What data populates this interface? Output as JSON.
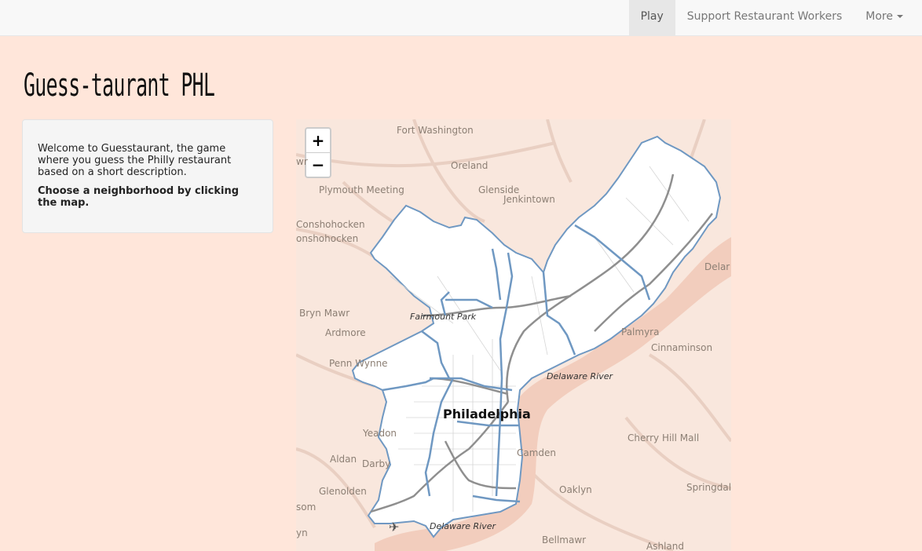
{
  "navbar": {
    "items": [
      {
        "label": "Play",
        "active": true
      },
      {
        "label": "Support Restaurant Workers"
      },
      {
        "label": "More"
      }
    ]
  },
  "page": {
    "title": "Guess-taurant PHL"
  },
  "sidebar": {
    "intro": "Welcome to Guesstaurant, the game where you guess the Philly restaurant based on a short description.",
    "instruction": "Choose a neighborhood by clicking the map."
  },
  "map": {
    "zoom_in": "+",
    "zoom_out": "−",
    "labels": {
      "fort_washington": "Fort Washington",
      "oreland": "Oreland",
      "plymouth_meeting": "Plymouth Meeting",
      "glenside": "Glenside",
      "jenkintown": "Jenkintown",
      "conshohocken": "Conshohocken",
      "w_conshohocken": "onshohocken",
      "bryn_mawr": "Bryn Mawr",
      "fairmount_park": "Fairmount Park",
      "ardmore": "Ardmore",
      "penn_wynne": "Penn Wynne",
      "philadelphia": "Philadelphia",
      "yeadon": "Yeadon",
      "aldan": "Aldan",
      "darby": "Darby",
      "glenolden": "Glenolden",
      "camden": "Camden",
      "oaklyn": "Oaklyn",
      "bellmawr": "Bellmawr",
      "ashland": "Ashland",
      "palmyra": "Palmyra",
      "cinnaminson": "Cinnaminson",
      "cherry_hill_mall": "Cherry Hill Mall",
      "springdale": "Springdal",
      "delaware_edge": "Delar",
      "delaware_river_1": "Delaware River",
      "delaware_river_2": "Delaware River",
      "swarthmore_edge": "som",
      "lyn_edge": "yn",
      "wr_edge": "wr"
    },
    "colors": {
      "background": "#f9e7dd",
      "city_fill": "#ffffff",
      "district_border": "#6f98c2",
      "roads": "#8f8f8f",
      "water": "#f2cdbd"
    }
  }
}
